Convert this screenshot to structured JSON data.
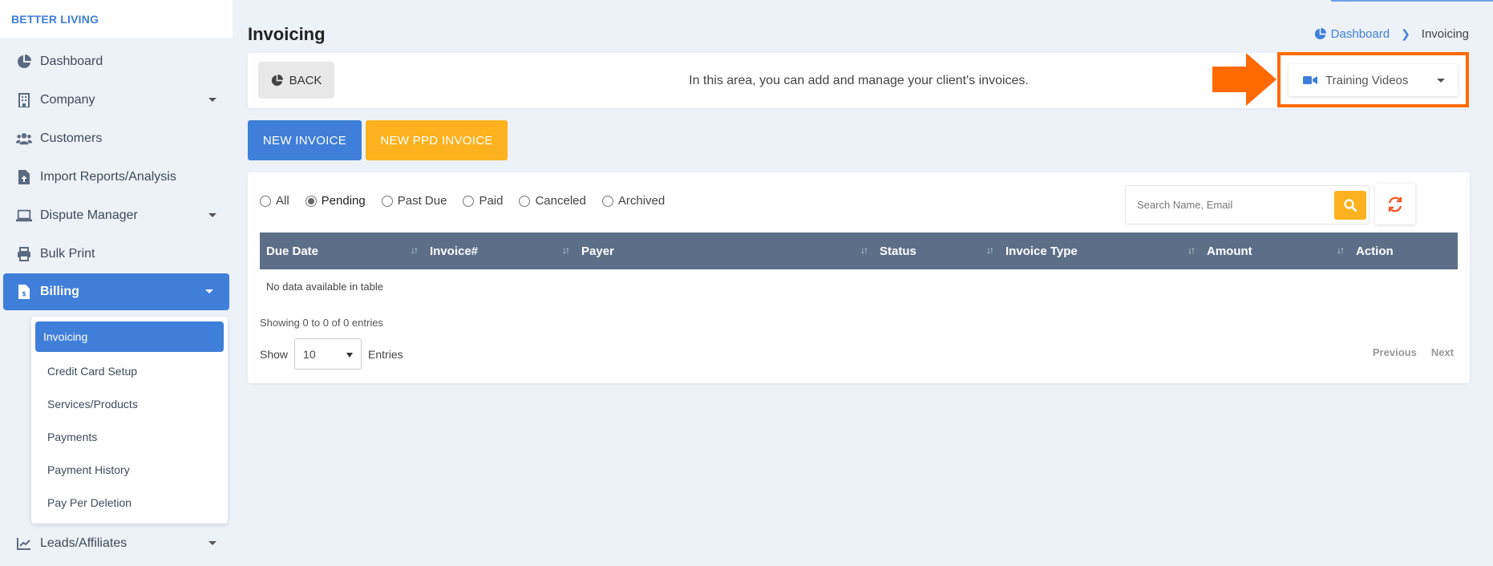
{
  "brand": "BETTER LIVING",
  "sidebar": {
    "items": [
      {
        "label": "Dashboard",
        "icon": "chart-pie-icon",
        "caret": false
      },
      {
        "label": "Company",
        "icon": "building-icon",
        "caret": true
      },
      {
        "label": "Customers",
        "icon": "users-icon",
        "caret": false
      },
      {
        "label": "Import Reports/Analysis",
        "icon": "file-upload-icon",
        "caret": false
      },
      {
        "label": "Dispute Manager",
        "icon": "laptop-icon",
        "caret": true
      },
      {
        "label": "Bulk Print",
        "icon": "printer-icon",
        "caret": false
      },
      {
        "label": "Billing",
        "icon": "invoice-icon",
        "caret": true,
        "active": true
      }
    ],
    "billing_submenu": [
      {
        "label": "Invoicing",
        "active": true
      },
      {
        "label": "Credit Card Setup"
      },
      {
        "label": "Services/Products"
      },
      {
        "label": "Payments"
      },
      {
        "label": "Payment History"
      },
      {
        "label": "Pay Per Deletion"
      }
    ],
    "bottom_item": {
      "label": "Leads/Affiliates",
      "icon": "chart-line-icon",
      "caret": true
    }
  },
  "header": {
    "title": "Invoicing",
    "breadcrumb": {
      "home": "Dashboard",
      "current": "Invoicing"
    }
  },
  "info_bar": {
    "back_label": "BACK",
    "message": "In this area, you can add and manage your client's invoices.",
    "training_label": "Training Videos"
  },
  "actions": {
    "new_invoice": "NEW INVOICE",
    "new_ppd_invoice": "NEW PPD INVOICE"
  },
  "filters": [
    {
      "label": "All",
      "checked": false
    },
    {
      "label": "Pending",
      "checked": true
    },
    {
      "label": "Past Due",
      "checked": false
    },
    {
      "label": "Paid",
      "checked": false
    },
    {
      "label": "Canceled",
      "checked": false
    },
    {
      "label": "Archived",
      "checked": false
    }
  ],
  "search": {
    "placeholder": "Search Name, Email"
  },
  "table": {
    "columns": [
      "Due Date",
      "Invoice#",
      "Payer",
      "Status",
      "Invoice Type",
      "Amount",
      "Action"
    ],
    "empty_message": "No data available in table",
    "showing": "Showing 0 to 0 of 0 entries",
    "show_label": "Show",
    "page_size": "10",
    "entries_label": "Entries",
    "previous": "Previous",
    "next": "Next"
  },
  "colors": {
    "primary": "#3f7fd9",
    "warning": "#fbb21e",
    "highlight": "#ff6a00",
    "table_header": "#5d6f88"
  }
}
